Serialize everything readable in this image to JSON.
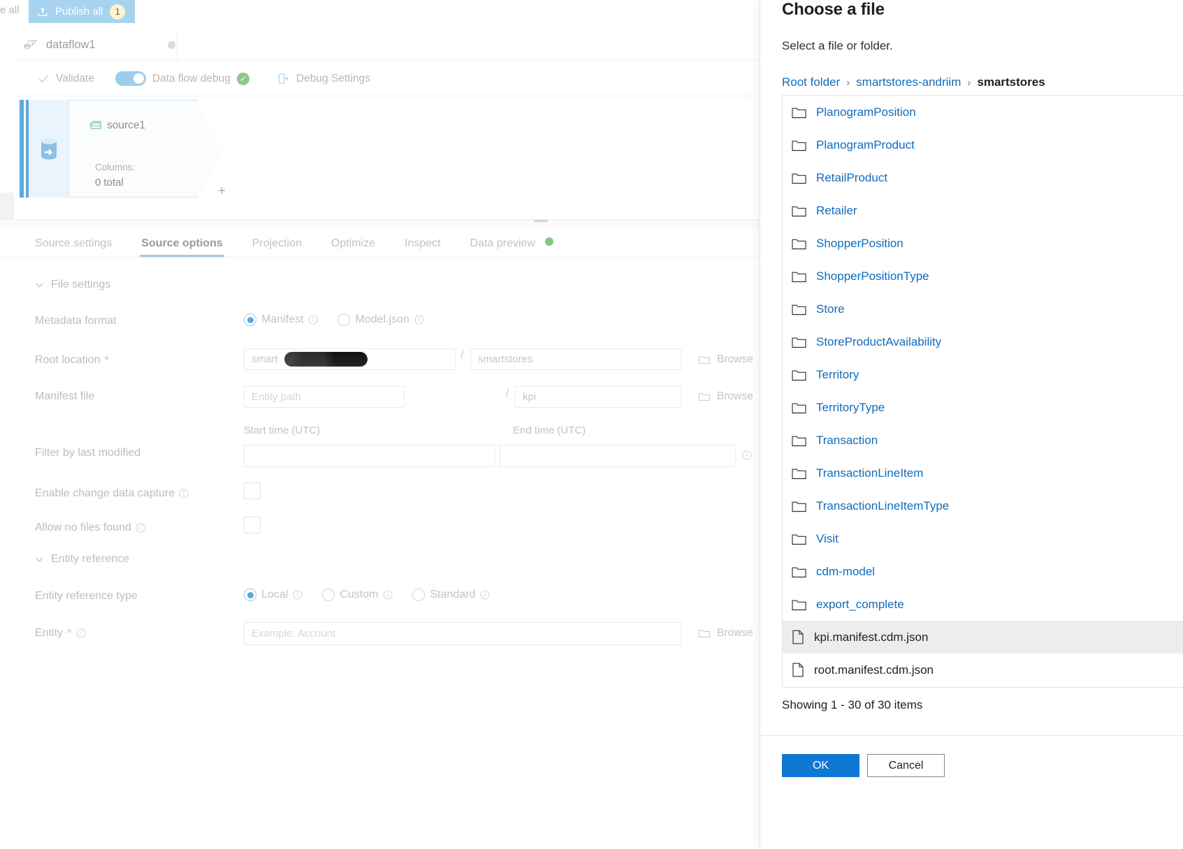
{
  "command_bar": {
    "discard_label": "e all",
    "publish_label": "Publish all",
    "publish_badge": "1",
    "upload_icon": "upload-icon"
  },
  "dataflow": {
    "name": "dataflow1",
    "name_icon": "dataflow-icon",
    "status_dot": "status-dot"
  },
  "toolbar": {
    "validate_label": "Validate",
    "validate_icon": "check-icon",
    "debug_toggle_label": "Data flow debug",
    "debug_toggle_state": "on",
    "debug_ok_glyph": "✓",
    "debug_settings_label": "Debug Settings",
    "debug_settings_icon": "debug-settings-icon"
  },
  "canvas": {
    "node": {
      "title": "source1",
      "title_icon": "database-stack-icon",
      "source_icon": "source-database-icon",
      "columns_label": "Columns:",
      "columns_value": "0 total",
      "add_glyph": "+"
    }
  },
  "tabs": [
    {
      "label": "Source settings",
      "active": false
    },
    {
      "label": "Source options",
      "active": true
    },
    {
      "label": "Projection",
      "active": false
    },
    {
      "label": "Optimize",
      "active": false
    },
    {
      "label": "Inspect",
      "active": false
    },
    {
      "label": "Data preview",
      "active": false,
      "status_dot": "green"
    }
  ],
  "form": {
    "file_settings_section": "File settings",
    "entity_reference_section": "Entity reference",
    "metadata_format": {
      "label": "Metadata format",
      "options": [
        {
          "label": "Manifest",
          "selected": true,
          "info": "info-icon"
        },
        {
          "label": "Model.json",
          "selected": false,
          "info": "info-icon"
        }
      ]
    },
    "root_location": {
      "label": "Root location",
      "required": "*",
      "container_value": "smart",
      "container_redacted": true,
      "folder_value": "smartstores",
      "separator": "/",
      "browse_label": "Browse"
    },
    "manifest_file": {
      "label": "Manifest file",
      "path_placeholder": "Entity path",
      "name_value": "kpi",
      "separator": "/",
      "browse_label": "Browse"
    },
    "filter_by_last_modified": {
      "label": "Filter by last modified",
      "start_label": "Start time (UTC)",
      "end_label": "End time (UTC)",
      "start_value": "",
      "end_value": "",
      "info": "info-icon"
    },
    "enable_change_data_capture": {
      "label": "Enable change data capture",
      "checked": false,
      "info": "info-icon"
    },
    "allow_no_files_found": {
      "label": "Allow no files found",
      "checked": false,
      "info": "info-icon"
    },
    "entity_reference_type": {
      "label": "Entity reference type",
      "options": [
        {
          "label": "Local",
          "selected": true,
          "info": "info-icon"
        },
        {
          "label": "Custom",
          "selected": false,
          "info": "info-icon"
        },
        {
          "label": "Standard",
          "selected": false,
          "info": "info-icon"
        }
      ]
    },
    "entity": {
      "label": "Entity",
      "required": "*",
      "placeholder": "Example: Account",
      "browse_label": "Browse",
      "info": "info-icon"
    }
  },
  "panel": {
    "title": "Choose a file",
    "subtitle": "Select a file or folder.",
    "breadcrumbs": [
      {
        "label": "Root folder",
        "current": false
      },
      {
        "label": "smartstores-andriim",
        "current": false
      },
      {
        "label": "smartstores",
        "current": true
      }
    ],
    "breadcrumb_separator": "›",
    "items": [
      {
        "name": "PlanogramPosition",
        "type": "folder",
        "selected": false
      },
      {
        "name": "PlanogramProduct",
        "type": "folder",
        "selected": false
      },
      {
        "name": "RetailProduct",
        "type": "folder",
        "selected": false
      },
      {
        "name": "Retailer",
        "type": "folder",
        "selected": false
      },
      {
        "name": "ShopperPosition",
        "type": "folder",
        "selected": false
      },
      {
        "name": "ShopperPositionType",
        "type": "folder",
        "selected": false
      },
      {
        "name": "Store",
        "type": "folder",
        "selected": false
      },
      {
        "name": "StoreProductAvailability",
        "type": "folder",
        "selected": false
      },
      {
        "name": "Territory",
        "type": "folder",
        "selected": false
      },
      {
        "name": "TerritoryType",
        "type": "folder",
        "selected": false
      },
      {
        "name": "Transaction",
        "type": "folder",
        "selected": false
      },
      {
        "name": "TransactionLineItem",
        "type": "folder",
        "selected": false
      },
      {
        "name": "TransactionLineItemType",
        "type": "folder",
        "selected": false
      },
      {
        "name": "Visit",
        "type": "folder",
        "selected": false
      },
      {
        "name": "cdm-model",
        "type": "folder",
        "selected": false
      },
      {
        "name": "export_complete",
        "type": "folder",
        "selected": false
      },
      {
        "name": "kpi.manifest.cdm.json",
        "type": "file",
        "selected": true
      },
      {
        "name": "root.manifest.cdm.json",
        "type": "file",
        "selected": false
      }
    ],
    "showing_text": "Showing 1 - 30 of 30 items",
    "ok_label": "OK",
    "cancel_label": "Cancel",
    "accent_color": "#0f78d4",
    "link_color": "#0f6cbd"
  }
}
